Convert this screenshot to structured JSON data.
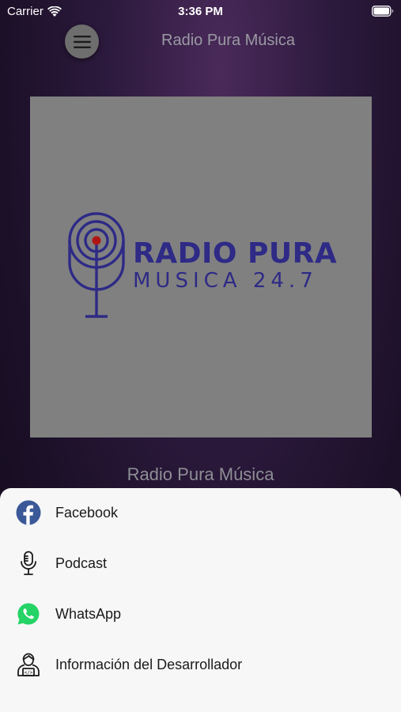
{
  "status_bar": {
    "carrier": "Carrier",
    "time": "3:36 PM"
  },
  "header": {
    "title": "Radio Pura Música",
    "menu_icon": "hamburger-icon"
  },
  "artwork": {
    "logo_line1": "RADIO PURA",
    "logo_line2": "MUSICA 24.7",
    "background": "#808080",
    "logo_color": "#2e2a86"
  },
  "now_playing": {
    "station_name": "Radio Pura Música"
  },
  "action_sheet": {
    "items": [
      {
        "label": "Facebook",
        "icon": "facebook-icon"
      },
      {
        "label": "Podcast",
        "icon": "microphone-icon"
      },
      {
        "label": "WhatsApp",
        "icon": "whatsapp-icon"
      },
      {
        "label": "Información del Desarrollador",
        "icon": "developer-icon"
      }
    ]
  },
  "colors": {
    "facebook": "#3b5998",
    "whatsapp": "#25d366",
    "accent_dot": "#b01515"
  }
}
